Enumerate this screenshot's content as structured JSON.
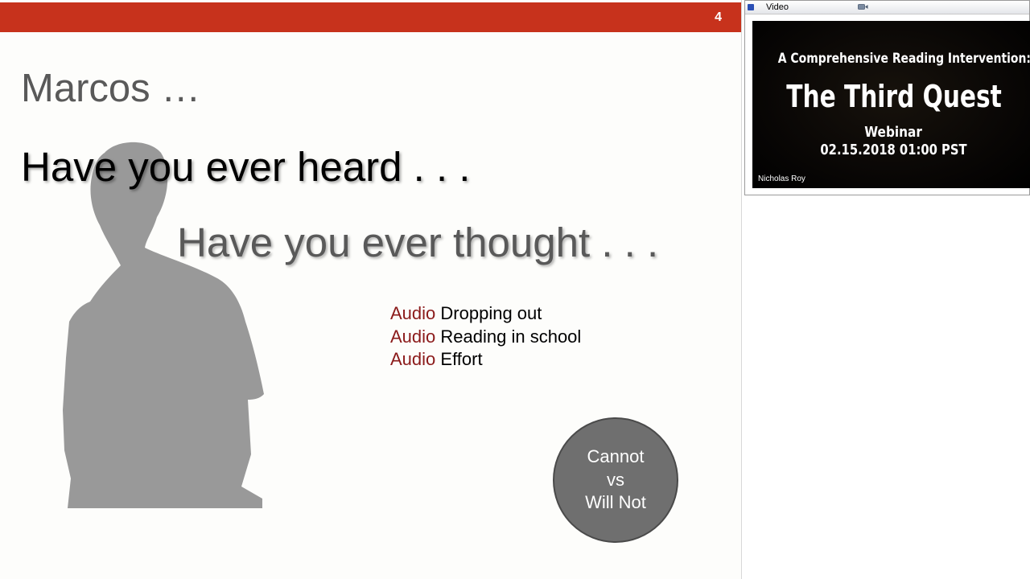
{
  "slide": {
    "page_number": "4",
    "title": "Marcos …",
    "line_heard": "Have you ever heard . . .",
    "line_thought": "Have you ever thought . . .",
    "audio_items": [
      {
        "tag": "Audio",
        "text": "Dropping out"
      },
      {
        "tag": "Audio",
        "text": "Reading in school"
      },
      {
        "tag": "Audio",
        "text": "Effort"
      }
    ],
    "circle": {
      "line1": "Cannot",
      "line2": "vs",
      "line3": "Will Not"
    }
  },
  "video_panel": {
    "title": "Video",
    "video_title_line1": "A Comprehensive Reading Intervention:",
    "video_title_line2": "The Third Quest",
    "video_title_line3": "Webinar",
    "video_title_line4": "02.15.2018 01:00 PST",
    "presenter": "Nicholas Roy"
  },
  "icons": {
    "panel_icon": "window-icon",
    "camera_icon": "camera-icon",
    "silhouette": "person-silhouette"
  },
  "colors": {
    "header_bar": "#c7321c",
    "audio_tag": "#8b1a1a",
    "circle_fill": "#6f6f6f",
    "silhouette": "#999999"
  }
}
